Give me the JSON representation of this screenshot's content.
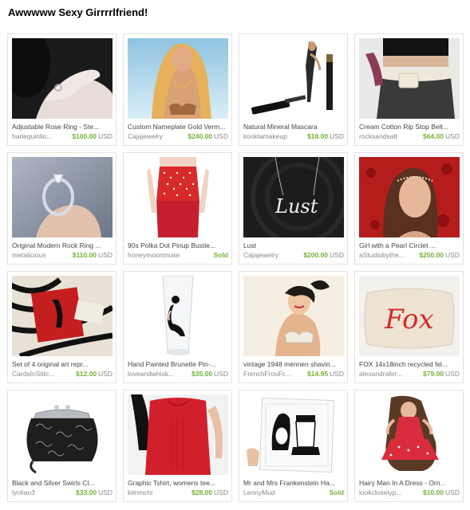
{
  "treasury": {
    "title": "Awwwww Sexy Girrrrlfriend!"
  },
  "items": [
    {
      "title": "Adjustable Rose Ring - Ste...",
      "shop": "harlequinlio...",
      "price": "$100.00",
      "currency": "USD",
      "sold": false,
      "thumb": "ring-hand-photo"
    },
    {
      "title": "Custom Nameplate Gold Verm...",
      "shop": "Cajajewelry",
      "price": "$240.00",
      "currency": "USD",
      "sold": false,
      "thumb": "bikini-model-photo"
    },
    {
      "title": "Natural Mineral Mascara",
      "shop": "kooklamakeup",
      "price": "$18.00",
      "currency": "USD",
      "sold": false,
      "thumb": "mascara-photo"
    },
    {
      "title": "Cream Cotton Rip Stop Belt...",
      "shop": "rocksandsalt",
      "price": "$64.00",
      "currency": "USD",
      "sold": false,
      "thumb": "belt-photo"
    },
    {
      "title": "Original Modern Rock Ring ...",
      "shop": "metalicious",
      "price": "$110.00",
      "currency": "USD",
      "sold": false,
      "thumb": "diamond-ring-photo"
    },
    {
      "title": "90s Polka Dot Pinup Bustie...",
      "shop": "honeymoonmuse",
      "price": "",
      "currency": "",
      "sold": true,
      "sold_label": "Sold",
      "thumb": "polka-dot-top-photo"
    },
    {
      "title": "Lust",
      "shop": "Cajajewelry",
      "price": "$200.00",
      "currency": "USD",
      "sold": false,
      "thumb": "lust-necklace-photo"
    },
    {
      "title": "Girl with a Pearl Circlet ...",
      "shop": "aStudiobythe...",
      "price": "$250.00",
      "currency": "USD",
      "sold": false,
      "thumb": "portrait-painting"
    },
    {
      "title": "Set of 4 original art repr...",
      "shop": "CardsInStitc...",
      "price": "$12.00",
      "currency": "USD",
      "sold": false,
      "thumb": "art-cards-photo"
    },
    {
      "title": "Hand Painted Brunette Pin-...",
      "shop": "loveandwhisk...",
      "price": "$35.00",
      "currency": "USD",
      "sold": false,
      "thumb": "painted-glass-photo"
    },
    {
      "title": "vintage 1948 mennen shavin...",
      "shop": "FrenchFrouFr...",
      "price": "$14.95",
      "currency": "USD",
      "sold": false,
      "thumb": "vintage-pinup-print"
    },
    {
      "title": "FOX 14x18inch recycled fel...",
      "shop": "alexandrafer...",
      "price": "$79.00",
      "currency": "USD",
      "sold": false,
      "thumb": "fox-pillow-photo",
      "pillow_text": "Fox"
    },
    {
      "title": "Black and Silver Swirls Cl...",
      "shop": "lynliao3",
      "price": "$33.00",
      "currency": "USD",
      "sold": false,
      "thumb": "clutch-purse-photo"
    },
    {
      "title": "Graphic Tshirt, womens tee...",
      "shop": "kimmchi",
      "price": "$28.00",
      "currency": "USD",
      "sold": false,
      "thumb": "red-tshirt-photo"
    },
    {
      "title": "Mr and Mrs Frankenstein Ha...",
      "shop": "LennyMud",
      "price": "",
      "currency": "",
      "sold": true,
      "sold_label": "Sold",
      "thumb": "frankenstein-plate-photo"
    },
    {
      "title": "Hairy Man In A Dress - Orn...",
      "shop": "lookcloselyp...",
      "price": "$10.00",
      "currency": "USD",
      "sold": false,
      "thumb": "ornament-photo"
    }
  ]
}
